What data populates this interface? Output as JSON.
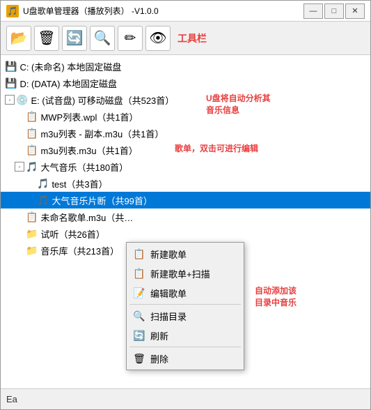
{
  "window": {
    "title": "U盘歌单管理器（播放列表）  -V1.0.0",
    "icon_symbol": "🎵",
    "min_label": "—",
    "max_label": "□",
    "close_label": "✕"
  },
  "toolbar": {
    "label": "工具栏",
    "buttons": [
      {
        "name": "open",
        "icon": "📂"
      },
      {
        "name": "delete",
        "icon": "🗑"
      },
      {
        "name": "refresh",
        "icon": "🔄"
      },
      {
        "name": "scan",
        "icon": "🔍"
      },
      {
        "name": "edit",
        "icon": "✏"
      },
      {
        "name": "settings",
        "icon": "👁"
      }
    ]
  },
  "tree": {
    "items": [
      {
        "id": "c-drive",
        "label": "C: (未命名) 本地固定磁盘",
        "indent": 0,
        "icon": "💾",
        "expand": null
      },
      {
        "id": "d-drive",
        "label": "D: (DATA) 本地固定磁盘",
        "indent": 0,
        "icon": "💾",
        "expand": null
      },
      {
        "id": "e-drive",
        "label": "E: (试音盘) 可移动磁盘（共523首）",
        "indent": 0,
        "icon": "💿",
        "expand": "-"
      },
      {
        "id": "mwp",
        "label": "MWP列表.wpl（共1首）",
        "indent": 1,
        "icon": "📋",
        "expand": null
      },
      {
        "id": "m3u-sub",
        "label": "m3u列表 - 副本.m3u（共1首）",
        "indent": 1,
        "icon": "📋",
        "expand": null
      },
      {
        "id": "m3u-main",
        "label": "m3u列表.m3u（共1首）",
        "indent": 1,
        "icon": "📋",
        "expand": null
      },
      {
        "id": "daqiyinyue",
        "label": "大气音乐（共180首）",
        "indent": 1,
        "icon": "🎵",
        "expand": "-"
      },
      {
        "id": "test",
        "label": "test（共3首）",
        "indent": 2,
        "icon": "🎵",
        "expand": null
      },
      {
        "id": "daqipianDuan",
        "label": "大气音乐片断（共99首）",
        "indent": 2,
        "icon": "🎵",
        "expand": null,
        "selected": true
      },
      {
        "id": "unnamed",
        "label": "未命名歌单.m3u（共…",
        "indent": 1,
        "icon": "📋",
        "expand": null
      },
      {
        "id": "shiting",
        "label": "试听（共26首）",
        "indent": 1,
        "icon": "📁",
        "expand": null
      },
      {
        "id": "yinyueku",
        "label": "音乐库（共213首）",
        "indent": 1,
        "icon": "📁",
        "expand": null
      }
    ]
  },
  "annotations": {
    "usb_auto": "U盘将自动分析其\n音乐信息",
    "playlist_edit": "歌单，双击可进行编辑",
    "auto_add": "自动添加该\n目录中音乐"
  },
  "context_menu": {
    "items": [
      {
        "id": "new-playlist",
        "label": "新建歌单",
        "icon": "📋"
      },
      {
        "id": "new-playlist-scan",
        "label": "新建歌单+扫描",
        "icon": "📋"
      },
      {
        "id": "edit-playlist",
        "label": "编辑歌单",
        "icon": "📝"
      },
      {
        "divider": true
      },
      {
        "id": "scan-dir",
        "label": "扫描目录",
        "icon": "🔍"
      },
      {
        "id": "refresh",
        "label": "刷新",
        "icon": "🔄"
      },
      {
        "divider": true
      },
      {
        "id": "delete",
        "label": "删除",
        "icon": "🗑"
      }
    ]
  },
  "bottom": {
    "text": "Ea"
  }
}
